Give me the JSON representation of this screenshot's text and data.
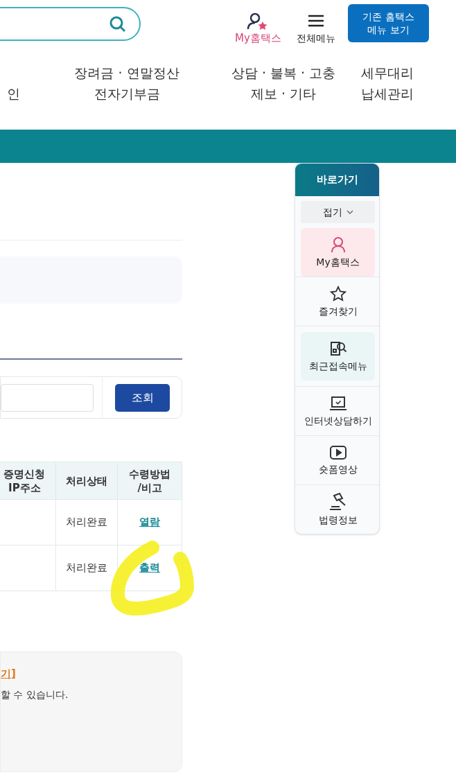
{
  "header": {
    "my_hometax": "My홈택스",
    "all_menu": "전체메뉴",
    "classic_button": "기존 홈택스\n메뉴 보기"
  },
  "nav": [
    "인",
    "장려금 · 연말정산\n전자기부금",
    "상담 · 불복 · 고충\n제보 · 기타",
    "세무대리\n납세관리"
  ],
  "search_button": "조회",
  "table": {
    "columns": [
      "증명신청\nIP주소",
      "처리상태",
      "수령방법\n/비고"
    ],
    "rows": [
      {
        "status": "처리완료",
        "receipt": "열람"
      },
      {
        "status": "처리완료",
        "receipt": "출력"
      }
    ]
  },
  "notice": {
    "title": "기]",
    "text": "할 수 있습니다."
  },
  "quick_links": {
    "title": "바로가기",
    "collapse": "접기",
    "items": [
      {
        "kind": "person",
        "label": "My홈택스",
        "color": "#fde8ec"
      },
      {
        "kind": "star",
        "label": "즐겨찾기"
      },
      {
        "kind": "recent",
        "label": "최근접속메뉴",
        "color": "#eaf6f5"
      },
      {
        "kind": "laptop",
        "label": "인터넷상담하기"
      },
      {
        "kind": "video",
        "label": "숏폼영상"
      },
      {
        "kind": "gavel",
        "label": "법령정보"
      }
    ]
  }
}
